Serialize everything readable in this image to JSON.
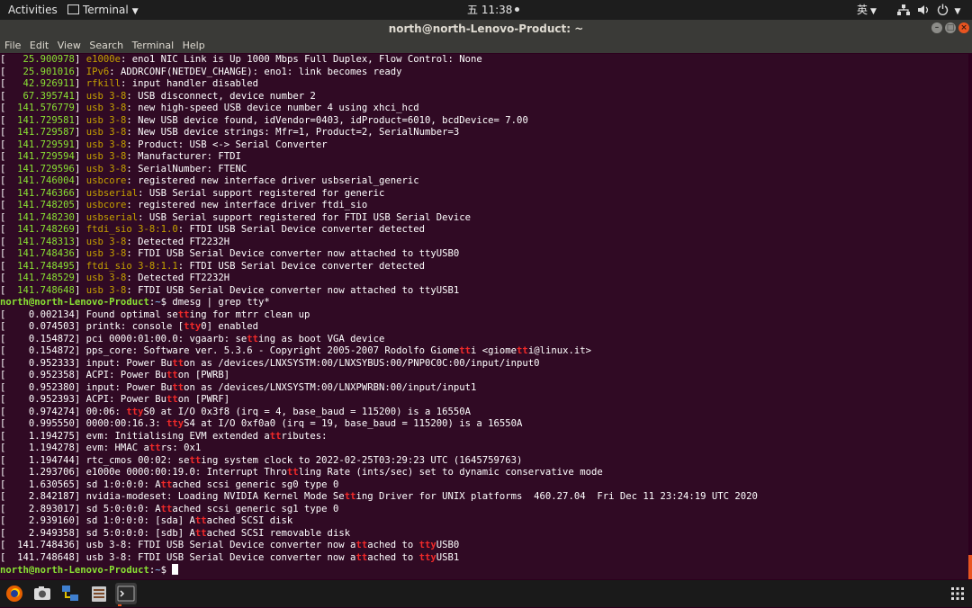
{
  "topbar": {
    "activities": "Activities",
    "app_menu": "Terminal",
    "clock": "五 11:38",
    "input_method": "英"
  },
  "window": {
    "title": "north@north-Lenovo-Product: ~"
  },
  "menubar": [
    "File",
    "Edit",
    "View",
    "Search",
    "Terminal",
    "Help"
  ],
  "terminal": {
    "prompt_user": "north@north-Lenovo-Product",
    "prompt_path": "~",
    "command": "dmesg | grep tty*",
    "lines": [
      {
        "type": "log",
        "ts": "   25.900978",
        "kw": "e1000e",
        "rest": ": eno1 NIC Link is Up 1000 Mbps Full Duplex, Flow Control: None"
      },
      {
        "type": "log",
        "ts": "   25.901016",
        "kw": "IPv6",
        "rest": ": ADDRCONF(NETDEV_CHANGE): eno1: link becomes ready"
      },
      {
        "type": "log",
        "ts": "   42.926911",
        "kw": "rfkill",
        "rest": ": input handler disabled"
      },
      {
        "type": "log",
        "ts": "   67.395741",
        "kw": "usb 3-8",
        "rest": ": USB disconnect, device number 2"
      },
      {
        "type": "log",
        "ts": "  141.576779",
        "kw": "usb 3-8",
        "rest": ": new high-speed USB device number 4 using xhci_hcd"
      },
      {
        "type": "log",
        "ts": "  141.729581",
        "kw": "usb 3-8",
        "rest": ": New USB device found, idVendor=0403, idProduct=6010, bcdDevice= 7.00"
      },
      {
        "type": "log",
        "ts": "  141.729587",
        "kw": "usb 3-8",
        "rest": ": New USB device strings: Mfr=1, Product=2, SerialNumber=3"
      },
      {
        "type": "log",
        "ts": "  141.729591",
        "kw": "usb 3-8",
        "rest": ": Product: USB <-> Serial Converter"
      },
      {
        "type": "log",
        "ts": "  141.729594",
        "kw": "usb 3-8",
        "rest": ": Manufacturer: FTDI"
      },
      {
        "type": "log",
        "ts": "  141.729596",
        "kw": "usb 3-8",
        "rest": ": SerialNumber: FTENC"
      },
      {
        "type": "log",
        "ts": "  141.746004",
        "kw": "usbcore",
        "rest": ": registered new interface driver usbserial_generic"
      },
      {
        "type": "log",
        "ts": "  141.746366",
        "kw": "usbserial",
        "rest": ": USB Serial support registered for generic"
      },
      {
        "type": "log",
        "ts": "  141.748205",
        "kw": "usbcore",
        "rest": ": registered new interface driver ftdi_sio"
      },
      {
        "type": "log",
        "ts": "  141.748230",
        "kw": "usbserial",
        "rest": ": USB Serial support registered for FTDI USB Serial Device"
      },
      {
        "type": "log",
        "ts": "  141.748269",
        "kw": "ftdi_sio 3-8:1.0",
        "rest": ": FTDI USB Serial Device converter detected"
      },
      {
        "type": "log",
        "ts": "  141.748313",
        "kw": "usb 3-8",
        "rest": ": Detected FT2232H"
      },
      {
        "type": "log",
        "ts": "  141.748436",
        "kw": "usb 3-8",
        "rest": ": FTDI USB Serial Device converter now attached to ttyUSB0"
      },
      {
        "type": "log",
        "ts": "  141.748495",
        "kw": "ftdi_sio 3-8:1.1",
        "rest": ": FTDI USB Serial Device converter detected"
      },
      {
        "type": "log",
        "ts": "  141.748529",
        "kw": "usb 3-8",
        "rest": ": Detected FT2232H"
      },
      {
        "type": "log",
        "ts": "  141.748648",
        "kw": "usb 3-8",
        "rest": ": FTDI USB Serial Device converter now attached to ttyUSB1"
      },
      {
        "type": "prompt",
        "cmd": "dmesg | grep tty*"
      },
      {
        "type": "grep",
        "segs": [
          "[    0.002134] Found optimal se",
          "tt",
          "ing for mtrr clean up"
        ]
      },
      {
        "type": "grep",
        "segs": [
          "[    0.074503] printk: console [",
          "tty",
          "0] enabled"
        ]
      },
      {
        "type": "grep",
        "segs": [
          "[    0.154872] pci 0000:01:00.0: vgaarb: se",
          "tt",
          "ing as boot VGA device"
        ]
      },
      {
        "type": "grep",
        "segs": [
          "[    0.154872] pps_core: Software ver. 5.3.6 - Copyright 2005-2007 Rodolfo Giome",
          "tt",
          "i <giome",
          "tt",
          "i@linux.it>"
        ]
      },
      {
        "type": "grep",
        "segs": [
          "[    0.952333] input: Power Bu",
          "tt",
          "on as /devices/LNXSYSTM:00/LNXSYBUS:00/PNP0C0C:00/input/input0"
        ]
      },
      {
        "type": "grep",
        "segs": [
          "[    0.952358] ACPI: Power Bu",
          "tt",
          "on [PWRB]"
        ]
      },
      {
        "type": "grep",
        "segs": [
          "[    0.952380] input: Power Bu",
          "tt",
          "on as /devices/LNXSYSTM:00/LNXPWRBN:00/input/input1"
        ]
      },
      {
        "type": "grep",
        "segs": [
          "[    0.952393] ACPI: Power Bu",
          "tt",
          "on [PWRF]"
        ]
      },
      {
        "type": "grep",
        "segs": [
          "[    0.974274] 00:06: ",
          "tty",
          "S0 at I/O 0x3f8 (irq = 4, base_baud = 115200) is a 16550A"
        ]
      },
      {
        "type": "grep",
        "segs": [
          "[    0.995550] 0000:00:16.3: ",
          "tty",
          "S4 at I/O 0xf0a0 (irq = 19, base_baud = 115200) is a 16550A"
        ]
      },
      {
        "type": "grep",
        "segs": [
          "[    1.194275] evm: Initialising EVM extended a",
          "tt",
          "ributes:"
        ]
      },
      {
        "type": "grep",
        "segs": [
          "[    1.194278] evm: HMAC a",
          "tt",
          "rs: 0x1"
        ]
      },
      {
        "type": "grep",
        "segs": [
          "[    1.194744] rtc_cmos 00:02: se",
          "tt",
          "ing system clock to 2022-02-25T03:29:23 UTC (1645759763)"
        ]
      },
      {
        "type": "grep",
        "segs": [
          "[    1.293706] e1000e 0000:00:19.0: Interrupt Thro",
          "tt",
          "ling Rate (ints/sec) set to dynamic conservative mode"
        ]
      },
      {
        "type": "grep",
        "segs": [
          "[    1.630565] sd 1:0:0:0: A",
          "tt",
          "ached scsi generic sg0 type 0"
        ]
      },
      {
        "type": "grep",
        "segs": [
          "[    2.842187] nvidia-modeset: Loading NVIDIA Kernel Mode Se",
          "tt",
          "ing Driver for UNIX platforms  460.27.04  Fri Dec 11 23:24:19 UTC 2020"
        ]
      },
      {
        "type": "grep",
        "segs": [
          "[    2.893017] sd 5:0:0:0: A",
          "tt",
          "ached scsi generic sg1 type 0"
        ]
      },
      {
        "type": "grep",
        "segs": [
          "[    2.939160] sd 1:0:0:0: [sda] A",
          "tt",
          "ached SCSI disk"
        ]
      },
      {
        "type": "grep",
        "segs": [
          "[    2.949358] sd 5:0:0:0: [sdb] A",
          "tt",
          "ached SCSI removable disk"
        ]
      },
      {
        "type": "grep",
        "segs": [
          "[  141.748436] usb 3-8: FTDI USB Serial Device converter now a",
          "tt",
          "ached to ",
          "tty",
          "USB0"
        ]
      },
      {
        "type": "grep",
        "segs": [
          "[  141.748648] usb 3-8: FTDI USB Serial Device converter now a",
          "tt",
          "ached to ",
          "tty",
          "USB1"
        ]
      },
      {
        "type": "prompt",
        "cmd": ""
      }
    ]
  },
  "colors": {
    "terminal_bg": "#300a24",
    "timestamp": "#8ae234",
    "keyword": "#c4a000",
    "match_highlight": "#ef2929",
    "prompt_user": "#8ae234",
    "prompt_path": "#729fcf",
    "accent": "#e95420"
  },
  "dock_icons": [
    "firefox-icon",
    "camera-icon",
    "network-icon",
    "files-icon",
    "terminal-icon",
    "app-grid-icon"
  ]
}
